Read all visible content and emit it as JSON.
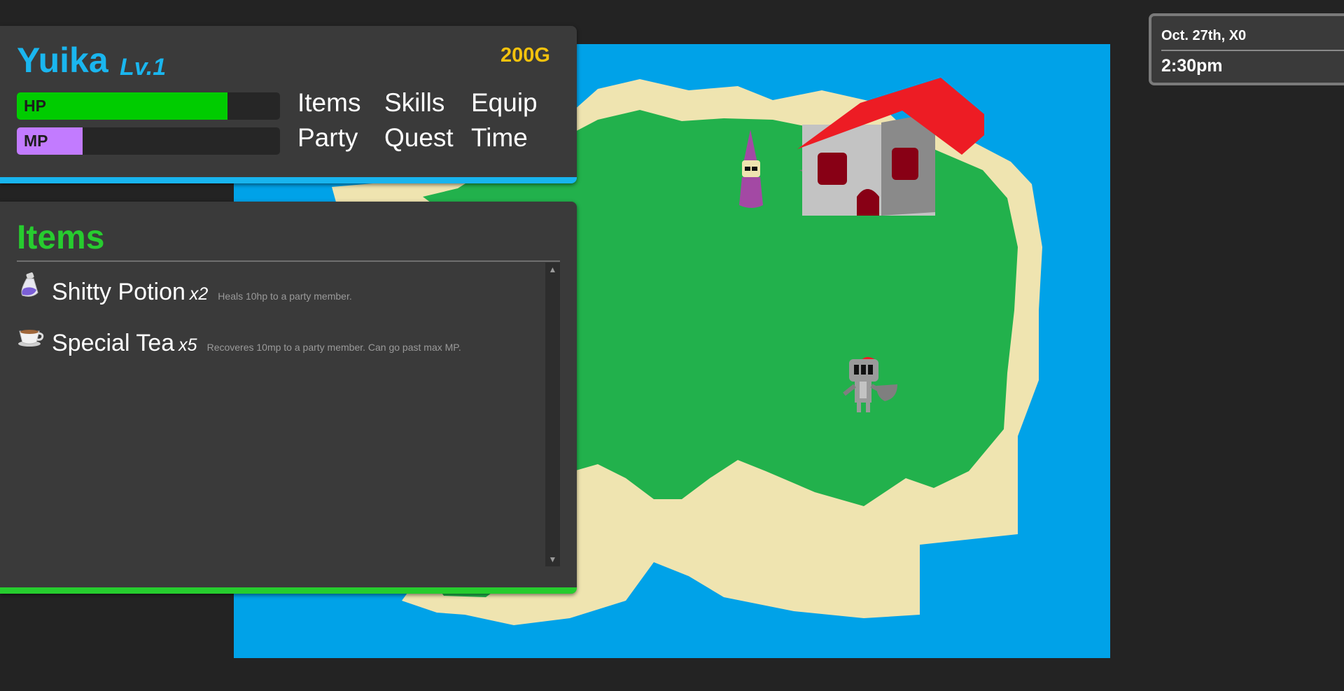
{
  "character": {
    "name": "Yuika",
    "level": "Lv.1",
    "gold": "200G"
  },
  "stats": {
    "hp": {
      "label": "HP",
      "fill": 0.8,
      "color": "#00cc00"
    },
    "mp": {
      "label": "MP",
      "fill": 0.25,
      "color": "#c27bff"
    }
  },
  "menu": {
    "items": "Items",
    "skills": "Skills",
    "equip": "Equip",
    "party": "Party",
    "quest": "Quest",
    "time": "Time"
  },
  "items_panel": {
    "title": "Items",
    "items": [
      {
        "icon": "potion-icon",
        "name": "Shitty Potion",
        "qty": "x2",
        "desc": "Heals 10hp to a party member."
      },
      {
        "icon": "teacup-icon",
        "name": "Special Tea",
        "qty": "x5",
        "desc": "Recoveres 10mp to a party member. Can go past max MP."
      }
    ]
  },
  "clock": {
    "date": "Oct. 27th, X0",
    "time": "2:30pm"
  },
  "colors": {
    "accent_blue": "#1ab6ef",
    "accent_green": "#27cc2f",
    "gold": "#f4c20d",
    "sea": "#00a2e8",
    "sand": "#efe4b0",
    "grass": "#22b14c",
    "roof": "#ed1c24"
  },
  "map": {
    "icons": [
      "wizard-npc-icon",
      "knight-player-icon",
      "house-icon"
    ]
  }
}
